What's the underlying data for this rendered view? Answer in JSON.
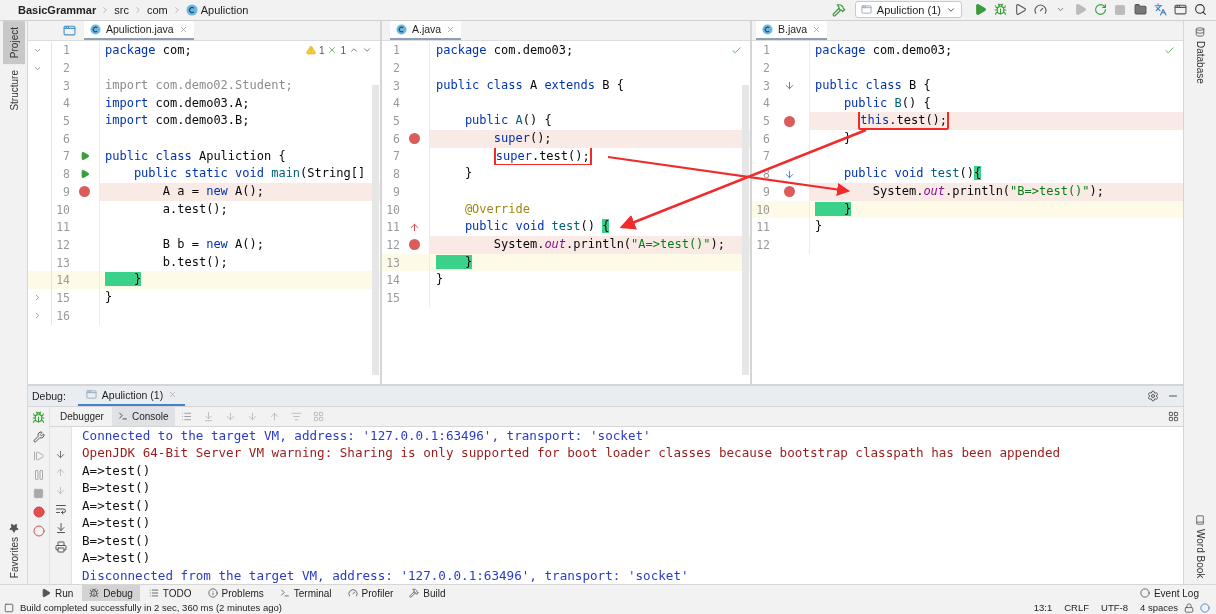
{
  "breadcrumbs": [
    {
      "label": "BasicGrammar",
      "kind": "project"
    },
    {
      "label": "src",
      "kind": "folder"
    },
    {
      "label": "com",
      "kind": "folder"
    },
    {
      "label": "Apuliction",
      "kind": "class"
    }
  ],
  "run_config": {
    "label": "Apuliction (1)"
  },
  "left_stripe": [
    {
      "label": "Project",
      "selected": true
    },
    {
      "label": "Structure",
      "selected": false
    }
  ],
  "left_stripe_bottom": [
    {
      "label": "Favorites",
      "selected": false
    }
  ],
  "right_stripe": [
    {
      "label": "Database",
      "selected": false
    }
  ],
  "right_stripe_bottom": [
    {
      "label": "Word Book",
      "selected": false
    }
  ],
  "editors": [
    {
      "tab": {
        "label": "Apuliction.java",
        "selected": true
      },
      "inspection": {
        "kind": "issues",
        "warnings": "1",
        "weak_warnings": "1"
      },
      "lines": [
        {
          "number": "1",
          "expanded": true,
          "tokens": [
            {
              "text": "package",
              "kind": "keyword"
            },
            {
              "text": " com;",
              "kind": "plain"
            }
          ]
        },
        {
          "number": "2",
          "expanded": true
        },
        {
          "number": "3",
          "tokens": [
            {
              "text": "import com.demo02.Student;",
              "kind": "unused"
            }
          ]
        },
        {
          "number": "4",
          "tokens": [
            {
              "text": "import",
              "kind": "keyword"
            },
            {
              "text": " com.demo03.A;",
              "kind": "plain"
            }
          ]
        },
        {
          "number": "5",
          "tokens": [
            {
              "text": "import",
              "kind": "keyword"
            },
            {
              "text": " com.demo03.B;",
              "kind": "plain"
            }
          ]
        },
        {
          "number": "6"
        },
        {
          "number": "7",
          "run": true,
          "tokens": [
            {
              "text": "public class",
              "kind": "keyword"
            },
            {
              "text": " Apuliction {",
              "kind": "plain"
            }
          ]
        },
        {
          "number": "8",
          "run": true,
          "tokens": [
            {
              "text": "    public static void",
              "kind": "keyword"
            },
            {
              "text": " main",
              "kind": "method"
            },
            {
              "text": "(String[]",
              "kind": "plain"
            }
          ]
        },
        {
          "number": "9",
          "breakpoint": true,
          "tokens": [
            {
              "text": "        A a = ",
              "kind": "plain"
            },
            {
              "text": "new",
              "kind": "keyword"
            },
            {
              "text": " A();",
              "kind": "plain"
            }
          ]
        },
        {
          "number": "10",
          "tokens": [
            {
              "text": "        a.test();",
              "kind": "plain"
            }
          ]
        },
        {
          "number": "11"
        },
        {
          "number": "12",
          "tokens": [
            {
              "text": "        B b = ",
              "kind": "plain"
            },
            {
              "text": "new",
              "kind": "keyword"
            },
            {
              "text": " A();",
              "kind": "plain"
            }
          ]
        },
        {
          "number": "13",
          "tokens": [
            {
              "text": "        b.test();",
              "kind": "plain"
            }
          ]
        },
        {
          "number": "14",
          "current": true,
          "tokens": [
            {
              "text": "    }",
              "kind": "brace"
            }
          ]
        },
        {
          "number": "15",
          "expanded": false,
          "tokens": [
            {
              "text": "}",
              "kind": "plain"
            }
          ]
        },
        {
          "number": "16",
          "expanded": false
        }
      ]
    },
    {
      "tab": {
        "label": "A.java",
        "selected": true
      },
      "inspection": {
        "kind": "ok"
      },
      "lines": [
        {
          "number": "1",
          "tokens": [
            {
              "text": "package",
              "kind": "keyword"
            },
            {
              "text": " com.demo03;",
              "kind": "plain"
            }
          ]
        },
        {
          "number": "2"
        },
        {
          "number": "3",
          "tokens": [
            {
              "text": "public class",
              "kind": "keyword"
            },
            {
              "text": " A ",
              "kind": "plain"
            },
            {
              "text": "extends",
              "kind": "keyword"
            },
            {
              "text": " B {",
              "kind": "plain"
            }
          ]
        },
        {
          "number": "4"
        },
        {
          "number": "5",
          "tokens": [
            {
              "text": "    public",
              "kind": "keyword"
            },
            {
              "text": " A",
              "kind": "method"
            },
            {
              "text": "() {",
              "kind": "plain"
            }
          ]
        },
        {
          "number": "6",
          "breakpoint": true,
          "tokens": [
            {
              "text": "        super",
              "kind": "keyword"
            },
            {
              "text": "();",
              "kind": "plain"
            }
          ]
        },
        {
          "number": "7",
          "tokens": [
            {
              "text": "        super",
              "kind": "keyword",
              "boxed": true
            },
            {
              "text": ".test();",
              "kind": "plain",
              "boxed": true
            }
          ]
        },
        {
          "number": "8",
          "tokens": [
            {
              "text": "    }",
              "kind": "plain"
            }
          ]
        },
        {
          "number": "9"
        },
        {
          "number": "10",
          "tokens": [
            {
              "text": "    @Override",
              "kind": "annotation"
            }
          ]
        },
        {
          "number": "11",
          "overrides": true,
          "tokens": [
            {
              "text": "    public void",
              "kind": "keyword"
            },
            {
              "text": " test",
              "kind": "method"
            },
            {
              "text": "() ",
              "kind": "plain"
            },
            {
              "text": "{",
              "kind": "brace"
            }
          ]
        },
        {
          "number": "12",
          "breakpoint": true,
          "tokens": [
            {
              "text": "        System.",
              "kind": "plain"
            },
            {
              "text": "out",
              "kind": "field"
            },
            {
              "text": ".println(",
              "kind": "plain"
            },
            {
              "text": "\"A=>test()\"",
              "kind": "string"
            },
            {
              "text": ");",
              "kind": "plain"
            }
          ]
        },
        {
          "number": "13",
          "current": true,
          "tokens": [
            {
              "text": "    }",
              "kind": "brace"
            }
          ]
        },
        {
          "number": "14",
          "tokens": [
            {
              "text": "}",
              "kind": "plain"
            }
          ]
        },
        {
          "number": "15"
        }
      ]
    },
    {
      "tab": {
        "label": "B.java",
        "selected": true
      },
      "inspection": {
        "kind": "ok"
      },
      "lines": [
        {
          "number": "1",
          "tokens": [
            {
              "text": "package",
              "kind": "keyword"
            },
            {
              "text": " com.demo03;",
              "kind": "plain"
            }
          ]
        },
        {
          "number": "2"
        },
        {
          "number": "3",
          "overridden": true,
          "tokens": [
            {
              "text": "public class",
              "kind": "keyword"
            },
            {
              "text": " B {",
              "kind": "plain"
            }
          ]
        },
        {
          "number": "4",
          "tokens": [
            {
              "text": "    public",
              "kind": "keyword"
            },
            {
              "text": " B",
              "kind": "method"
            },
            {
              "text": "() {",
              "kind": "plain"
            }
          ]
        },
        {
          "number": "5",
          "breakpoint": true,
          "tokens": [
            {
              "text": "      this",
              "kind": "keyword",
              "boxed": true
            },
            {
              "text": ".test();",
              "kind": "plain",
              "boxed": true
            }
          ]
        },
        {
          "number": "6",
          "tokens": [
            {
              "text": "    }",
              "kind": "plain"
            }
          ]
        },
        {
          "number": "7"
        },
        {
          "number": "8",
          "overridden": true,
          "tokens": [
            {
              "text": "    public void",
              "kind": "keyword"
            },
            {
              "text": " test",
              "kind": "method"
            },
            {
              "text": "()",
              "kind": "plain"
            },
            {
              "text": "{",
              "kind": "brace"
            }
          ]
        },
        {
          "number": "9",
          "breakpoint": true,
          "tokens": [
            {
              "text": "        System.",
              "kind": "plain"
            },
            {
              "text": "out",
              "kind": "field"
            },
            {
              "text": ".println(",
              "kind": "plain"
            },
            {
              "text": "\"B=>test()\"",
              "kind": "string"
            },
            {
              "text": ");",
              "kind": "plain"
            }
          ]
        },
        {
          "number": "10",
          "current": true,
          "tokens": [
            {
              "text": "    }",
              "kind": "brace"
            }
          ]
        },
        {
          "number": "11",
          "tokens": [
            {
              "text": "}",
              "kind": "plain"
            }
          ]
        },
        {
          "number": "12"
        }
      ]
    }
  ],
  "debug": {
    "label": "Debug:",
    "tabs": [
      {
        "label": "Apuliction (1)",
        "selected": true
      }
    ],
    "subtabs": [
      {
        "label": "Debugger",
        "selected": false
      },
      {
        "label": "Console",
        "selected": true
      }
    ],
    "console": [
      {
        "text": "Connected to the target VM, address: '127.0.0.1:63496', transport: 'socket'",
        "kind": "info"
      },
      {
        "text": "OpenJDK 64-Bit Server VM warning: Sharing is only supported for boot loader classes because bootstrap classpath has been appended",
        "kind": "error"
      },
      {
        "text": "A=>test()",
        "kind": "output"
      },
      {
        "text": "B=>test()",
        "kind": "output"
      },
      {
        "text": "A=>test()",
        "kind": "output"
      },
      {
        "text": "A=>test()",
        "kind": "output"
      },
      {
        "text": "B=>test()",
        "kind": "output"
      },
      {
        "text": "A=>test()",
        "kind": "output"
      },
      {
        "text": "Disconnected from the target VM, address: '127.0.0.1:63496', transport: 'socket'",
        "kind": "info"
      }
    ]
  },
  "tool_windows": [
    {
      "label": "Run",
      "kind": "run",
      "selected": false
    },
    {
      "label": "Debug",
      "kind": "debug",
      "selected": true
    },
    {
      "label": "TODO",
      "kind": "todo",
      "selected": false
    },
    {
      "label": "Problems",
      "kind": "problems",
      "selected": false
    },
    {
      "label": "Terminal",
      "kind": "terminal",
      "selected": false
    },
    {
      "label": "Profiler",
      "kind": "profiler",
      "selected": false
    },
    {
      "label": "Build",
      "kind": "build",
      "selected": false
    }
  ],
  "event_log": {
    "label": "Event Log"
  },
  "status_bar": {
    "message": "Build completed successfully in 2 sec, 360 ms (2 minutes ago)",
    "items": [
      "13:1",
      "CRLF",
      "UTF-8",
      "4 spaces"
    ]
  }
}
